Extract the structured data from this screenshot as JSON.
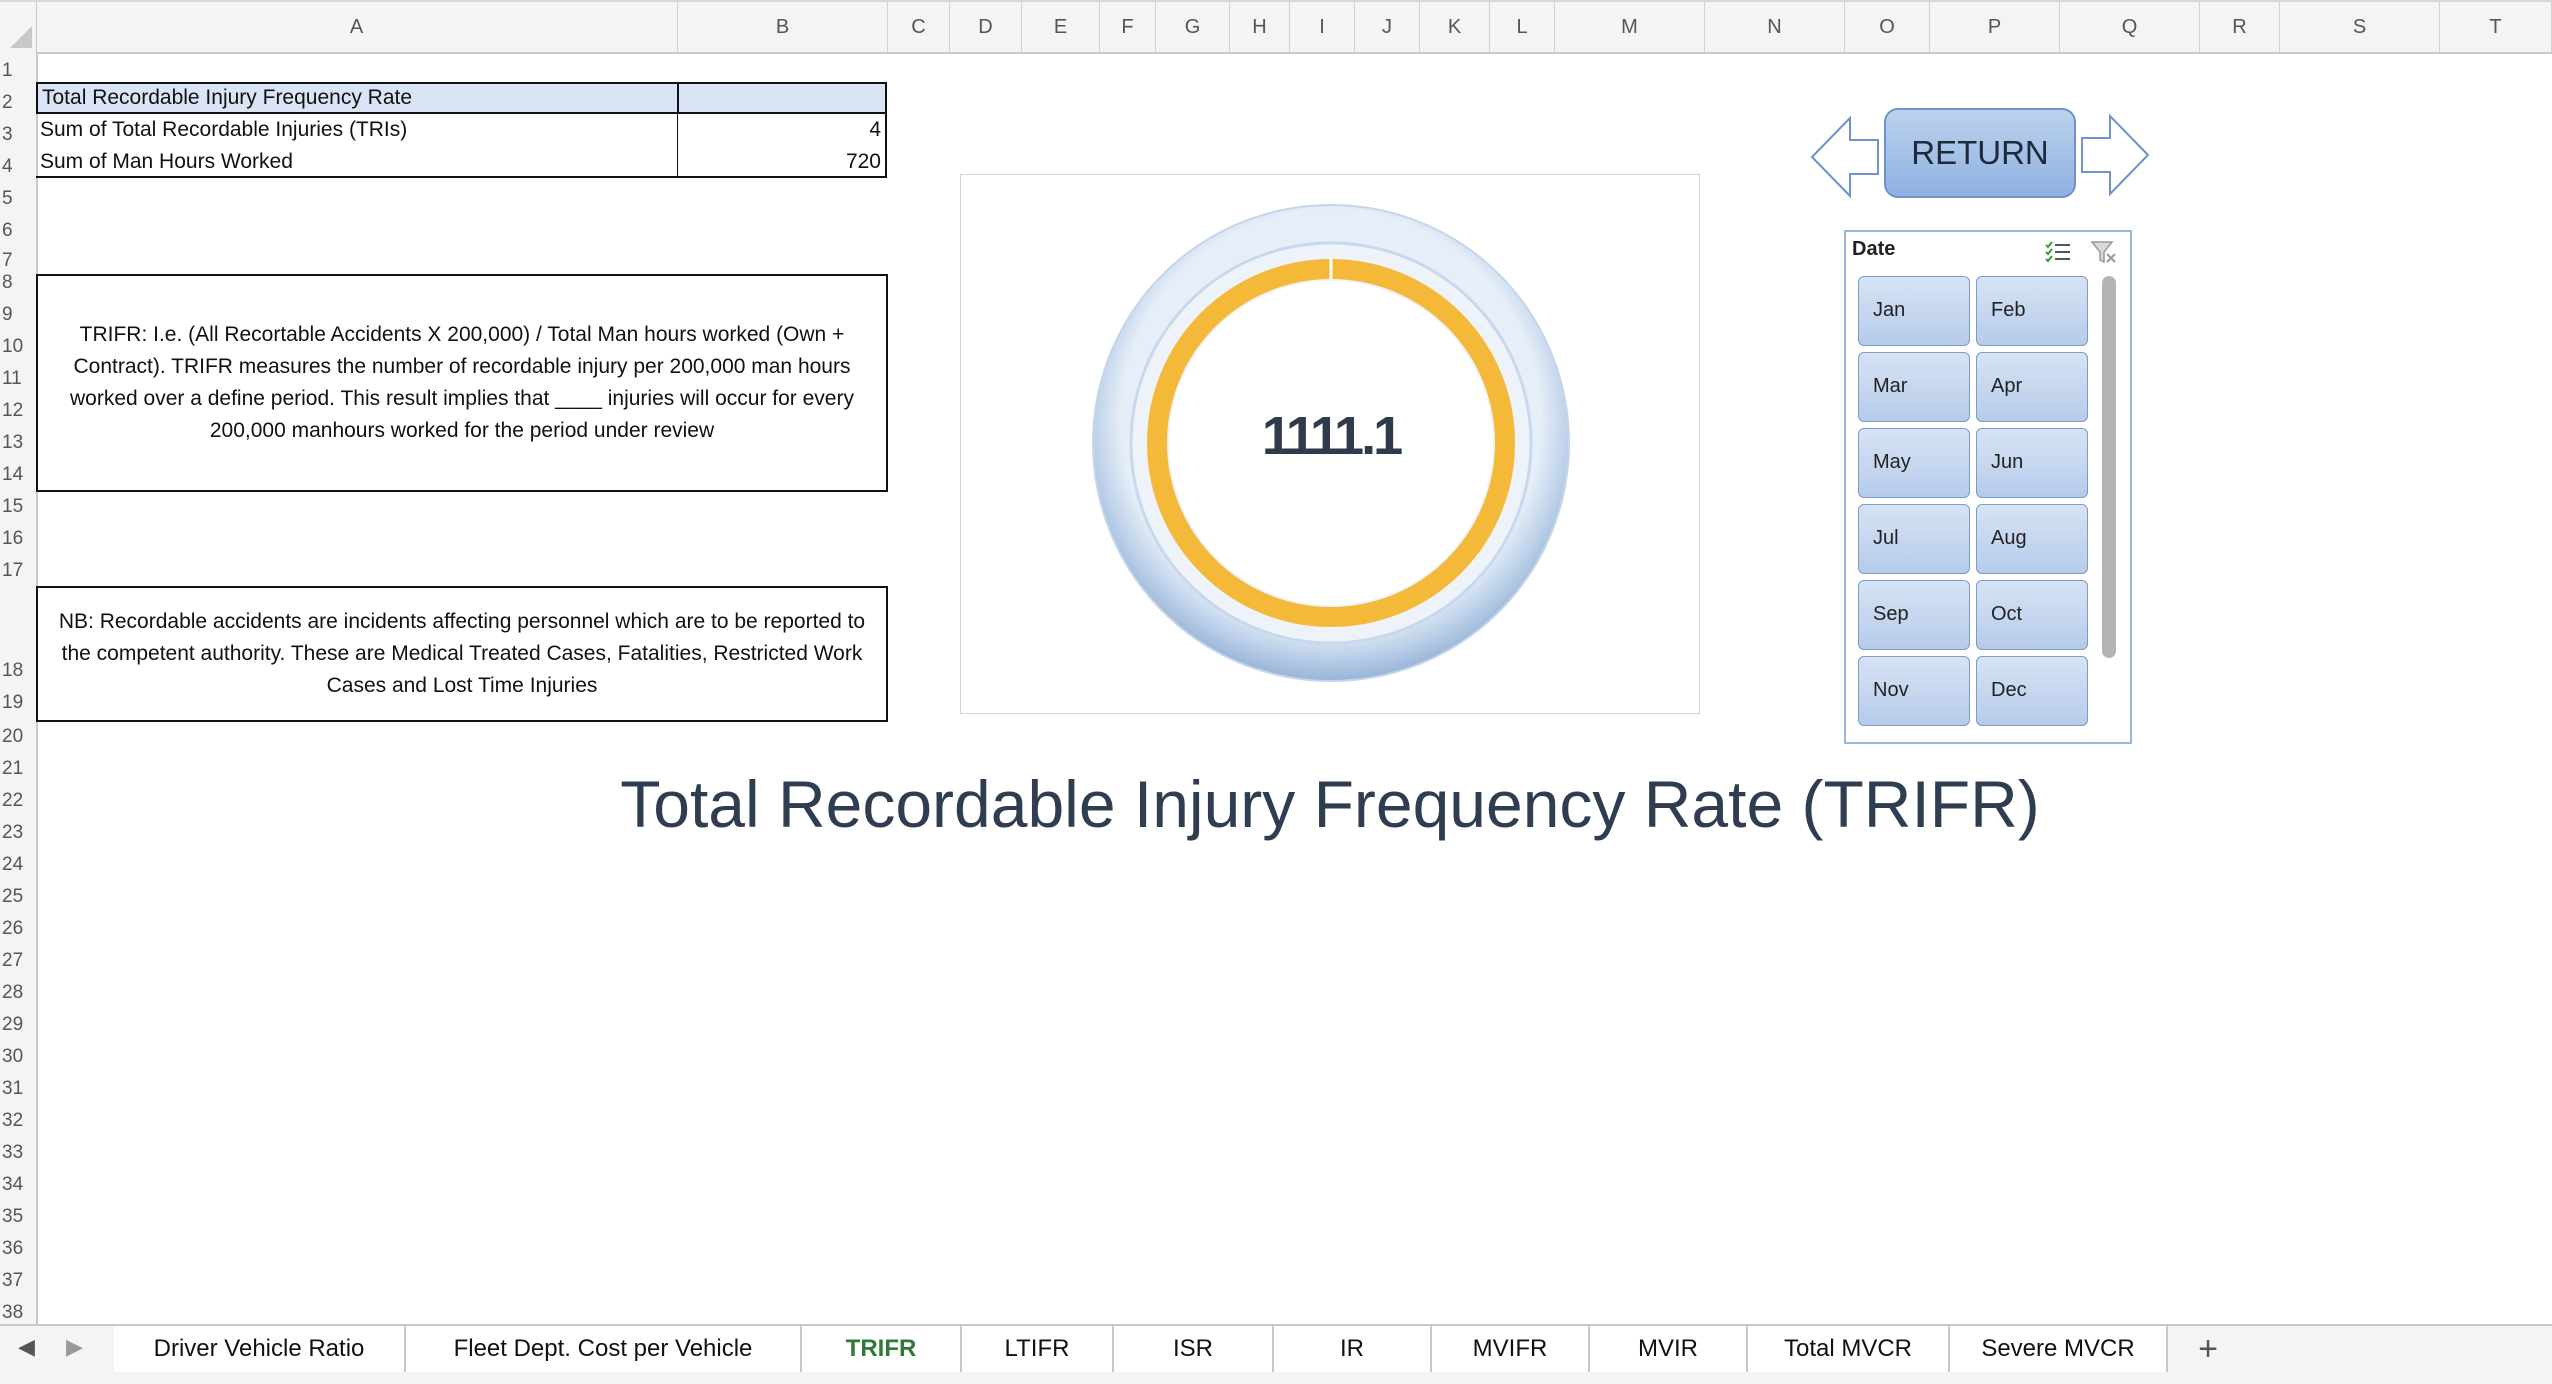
{
  "columns": [
    "A",
    "B",
    "C",
    "D",
    "E",
    "F",
    "G",
    "H",
    "I",
    "J",
    "K",
    "L",
    "M",
    "N",
    "O",
    "P",
    "Q",
    "R",
    "S",
    "T"
  ],
  "rows": [
    "1",
    "2",
    "3",
    "4",
    "5",
    "6",
    "7",
    "8",
    "9",
    "10",
    "11",
    "12",
    "13",
    "14",
    "15",
    "16",
    "17",
    "18",
    "19",
    "20",
    "21",
    "22",
    "23",
    "24",
    "25",
    "26",
    "27",
    "28",
    "29",
    "30",
    "31",
    "32",
    "33",
    "34",
    "35",
    "36",
    "37",
    "38"
  ],
  "summary_table": {
    "header": "Total Recordable Injury Frequency Rate",
    "header_value": "",
    "rows": [
      {
        "label": "Sum of Total Recordable Injuries (TRIs)",
        "value": "4"
      },
      {
        "label": "Sum of Man Hours Worked",
        "value": "720"
      }
    ]
  },
  "definition_text": "TRIFR: I.e. (All Recortable Accidents X 200,000) / Total Man hours worked (Own + Contract). TRIFR measures the number of recordable injury per 200,000 man hours worked over a define period. This result implies that ____ injuries will occur for every 200,000 manhours worked for the period under review",
  "note_text": "NB: Recordable accidents are incidents affecting personnel which are to be reported to the competent authority. These are Medical Treated Cases, Fatalities, Restricted Work Cases and Lost Time Injuries",
  "gauge": {
    "value_label": "1111.1",
    "fill_fraction": 1.0,
    "ring_color": "#f5b93a",
    "bezel_color": "#b9cfe8"
  },
  "nav": {
    "return_label": "RETURN",
    "prev_arrow_icon": "left-arrow-icon",
    "next_arrow_icon": "right-arrow-icon"
  },
  "slicer": {
    "title": "Date",
    "items": [
      "Jan",
      "Feb",
      "Mar",
      "Apr",
      "May",
      "Jun",
      "Jul",
      "Aug",
      "Sep",
      "Oct",
      "Nov",
      "Dec"
    ],
    "multiselect_icon": "multi-select-icon",
    "clear_filter_icon": "clear-filter-icon"
  },
  "page_title": "Total Recordable Injury Frequency Rate (TRIFR)",
  "sheet_tabs": [
    {
      "label": "Driver Vehicle Ratio",
      "active": false
    },
    {
      "label": "Fleet Dept. Cost per Vehicle",
      "active": false
    },
    {
      "label": "TRIFR",
      "active": true
    },
    {
      "label": "LTIFR",
      "active": false
    },
    {
      "label": "ISR",
      "active": false
    },
    {
      "label": "IR",
      "active": false
    },
    {
      "label": "MVIFR",
      "active": false
    },
    {
      "label": "MVIR",
      "active": false
    },
    {
      "label": "Total MVCR",
      "active": false
    },
    {
      "label": "Severe MVCR",
      "active": false
    }
  ],
  "add_sheet_label": "+"
}
